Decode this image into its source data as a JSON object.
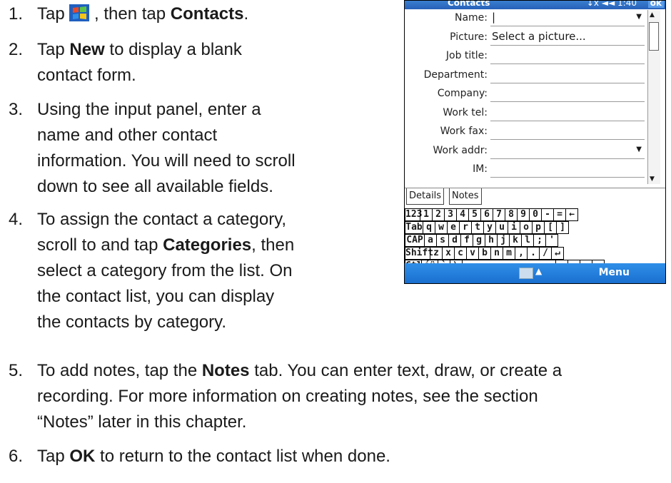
{
  "steps": [
    {
      "num": "1.",
      "pre": "Tap ",
      "mid": " , then tap ",
      "bold": "Contacts",
      "post": "."
    },
    {
      "num": "2.",
      "pre": "Tap ",
      "bold": "New",
      "l1rest": " to display a blank",
      "l2": "contact form."
    },
    {
      "num": "3.",
      "lines": [
        "Using the input panel, enter a",
        "name and other contact",
        "information. You will need to scroll",
        "down to see all available fields."
      ]
    },
    {
      "num": "4.",
      "l1": "To assign the contact a category,",
      "l2pre": "scroll to and tap ",
      "bold": "Categories",
      "l2post": ", then",
      "lines": [
        "select a category from the list. On",
        "the contact list, you can display",
        "the contacts by category."
      ]
    },
    {
      "num": "5.",
      "pre": "To add notes, tap the ",
      "bold": "Notes",
      "l1rest": " tab. You can enter text, draw, or create a",
      "lines": [
        "recording. For more information on creating notes, see the section",
        "“Notes” later in this chapter."
      ]
    },
    {
      "num": "6.",
      "pre": "Tap ",
      "bold": "OK",
      "post": " to return to the contact list when done."
    }
  ],
  "device": {
    "app_title": "Contacts",
    "status": "↓x ◄◄ 1:40",
    "ok": "ok",
    "fields": [
      {
        "label": "Name:",
        "value": "|",
        "dropdown": true
      },
      {
        "label": "Picture:",
        "value": "Select a picture...",
        "dropdown": false
      },
      {
        "label": "Job title:",
        "value": "",
        "dropdown": false
      },
      {
        "label": "Department:",
        "value": "",
        "dropdown": false
      },
      {
        "label": "Company:",
        "value": "",
        "dropdown": false
      },
      {
        "label": "Work tel:",
        "value": "",
        "dropdown": false
      },
      {
        "label": "Work fax:",
        "value": "",
        "dropdown": false
      },
      {
        "label": "Work addr:",
        "value": "",
        "dropdown": true
      },
      {
        "label": "IM:",
        "value": "",
        "dropdown": false
      }
    ],
    "tabs": [
      "Details",
      "Notes"
    ],
    "keyboard": [
      [
        "123",
        "1",
        "2",
        "3",
        "4",
        "5",
        "6",
        "7",
        "8",
        "9",
        "0",
        "-",
        "=",
        "←"
      ],
      [
        "Tab",
        "q",
        "w",
        "e",
        "r",
        "t",
        "y",
        "u",
        "i",
        "o",
        "p",
        "[",
        "]"
      ],
      [
        "CAP",
        "a",
        "s",
        "d",
        "f",
        "g",
        "h",
        "j",
        "k",
        "l",
        ";",
        "'"
      ],
      [
        "Shift",
        "z",
        "x",
        "c",
        "v",
        "b",
        "n",
        "m",
        ",",
        ".",
        "/",
        "↵"
      ],
      [
        "Ctl",
        "áü",
        "`",
        "\\",
        "",
        "↓",
        "↑",
        "←",
        "→"
      ]
    ],
    "menu": "Menu",
    "colors": {
      "titlebar": "#2660b8",
      "menubar": "#1a6fcf"
    }
  }
}
